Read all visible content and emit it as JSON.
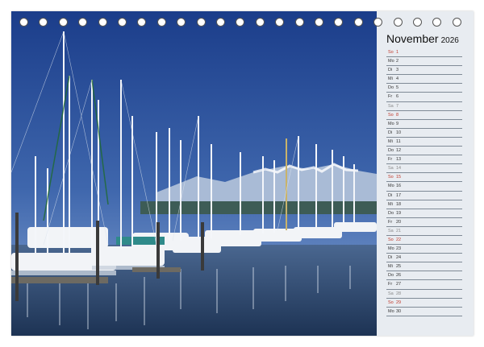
{
  "calendar": {
    "month": "November",
    "year": "2026",
    "days": [
      {
        "wd": "So",
        "d": "1",
        "kind": "sun"
      },
      {
        "wd": "Mo",
        "d": "2",
        "kind": "weekday"
      },
      {
        "wd": "Di",
        "d": "3",
        "kind": "weekday"
      },
      {
        "wd": "Mi",
        "d": "4",
        "kind": "weekday"
      },
      {
        "wd": "Do",
        "d": "5",
        "kind": "weekday"
      },
      {
        "wd": "Fr",
        "d": "6",
        "kind": "weekday"
      },
      {
        "wd": "Sa",
        "d": "7",
        "kind": "sat"
      },
      {
        "wd": "So",
        "d": "8",
        "kind": "sun"
      },
      {
        "wd": "Mo",
        "d": "9",
        "kind": "weekday"
      },
      {
        "wd": "Di",
        "d": "10",
        "kind": "weekday"
      },
      {
        "wd": "Mi",
        "d": "11",
        "kind": "weekday"
      },
      {
        "wd": "Do",
        "d": "12",
        "kind": "weekday"
      },
      {
        "wd": "Fr",
        "d": "13",
        "kind": "weekday"
      },
      {
        "wd": "Sa",
        "d": "14",
        "kind": "sat"
      },
      {
        "wd": "So",
        "d": "15",
        "kind": "sun"
      },
      {
        "wd": "Mo",
        "d": "16",
        "kind": "weekday"
      },
      {
        "wd": "Di",
        "d": "17",
        "kind": "weekday"
      },
      {
        "wd": "Mi",
        "d": "18",
        "kind": "weekday"
      },
      {
        "wd": "Do",
        "d": "19",
        "kind": "weekday"
      },
      {
        "wd": "Fr",
        "d": "20",
        "kind": "weekday"
      },
      {
        "wd": "Sa",
        "d": "21",
        "kind": "sat"
      },
      {
        "wd": "So",
        "d": "22",
        "kind": "sun"
      },
      {
        "wd": "Mo",
        "d": "23",
        "kind": "weekday"
      },
      {
        "wd": "Di",
        "d": "24",
        "kind": "weekday"
      },
      {
        "wd": "Mi",
        "d": "25",
        "kind": "weekday"
      },
      {
        "wd": "Do",
        "d": "26",
        "kind": "weekday"
      },
      {
        "wd": "Fr",
        "d": "27",
        "kind": "weekday"
      },
      {
        "wd": "Sa",
        "d": "28",
        "kind": "sat"
      },
      {
        "wd": "So",
        "d": "29",
        "kind": "sun"
      },
      {
        "wd": "Mo",
        "d": "30",
        "kind": "weekday"
      }
    ]
  },
  "colors": {
    "sky_top": "#1d3f8c",
    "sky_bottom": "#6c8fc4",
    "water": "#2b4469",
    "sidebar": "#e8ecf1",
    "sunday": "#c0392b"
  },
  "photo": {
    "subject": "marina-with-sailboats-icon"
  }
}
